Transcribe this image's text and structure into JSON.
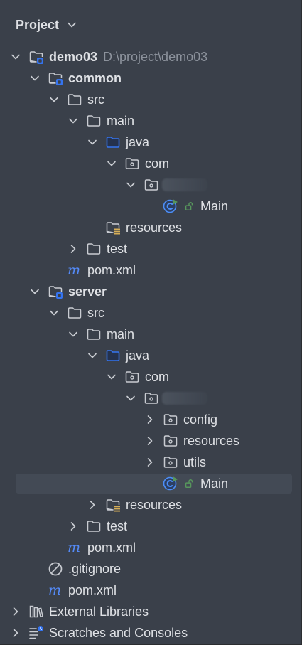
{
  "panel": {
    "title": "Project"
  },
  "colors": {
    "panel_bg": "#3a404a",
    "text": "#dfe1e5",
    "path_text": "#8c929c",
    "folder_outline": "#c9ccd2",
    "source_folder_blue": "#3574f0",
    "module_badge_blue": "#3574f0",
    "maven_blue": "#548af7",
    "class_blue": "#4c8ef7",
    "run_green": "#57965c",
    "resources_bar_yellow": "#d6ae58",
    "selection_bg": "#434a55"
  },
  "tree": {
    "root_label": "demo03",
    "root_path": "D:\\project\\demo03",
    "common": {
      "label": "common",
      "src": "src",
      "main": "main",
      "java": "java",
      "com": "com",
      "main_class": "Main",
      "resources": "resources",
      "test": "test",
      "pom": "pom.xml"
    },
    "server": {
      "label": "server",
      "src": "src",
      "main": "main",
      "java": "java",
      "com": "com",
      "config": "config",
      "resources_pkg": "resources",
      "utils": "utils",
      "main_class": "Main",
      "resources": "resources",
      "test": "test",
      "pom": "pom.xml"
    },
    "gitignore": ".gitignore",
    "root_pom": "pom.xml",
    "external_libraries": "External Libraries",
    "scratches": "Scratches and Consoles"
  }
}
